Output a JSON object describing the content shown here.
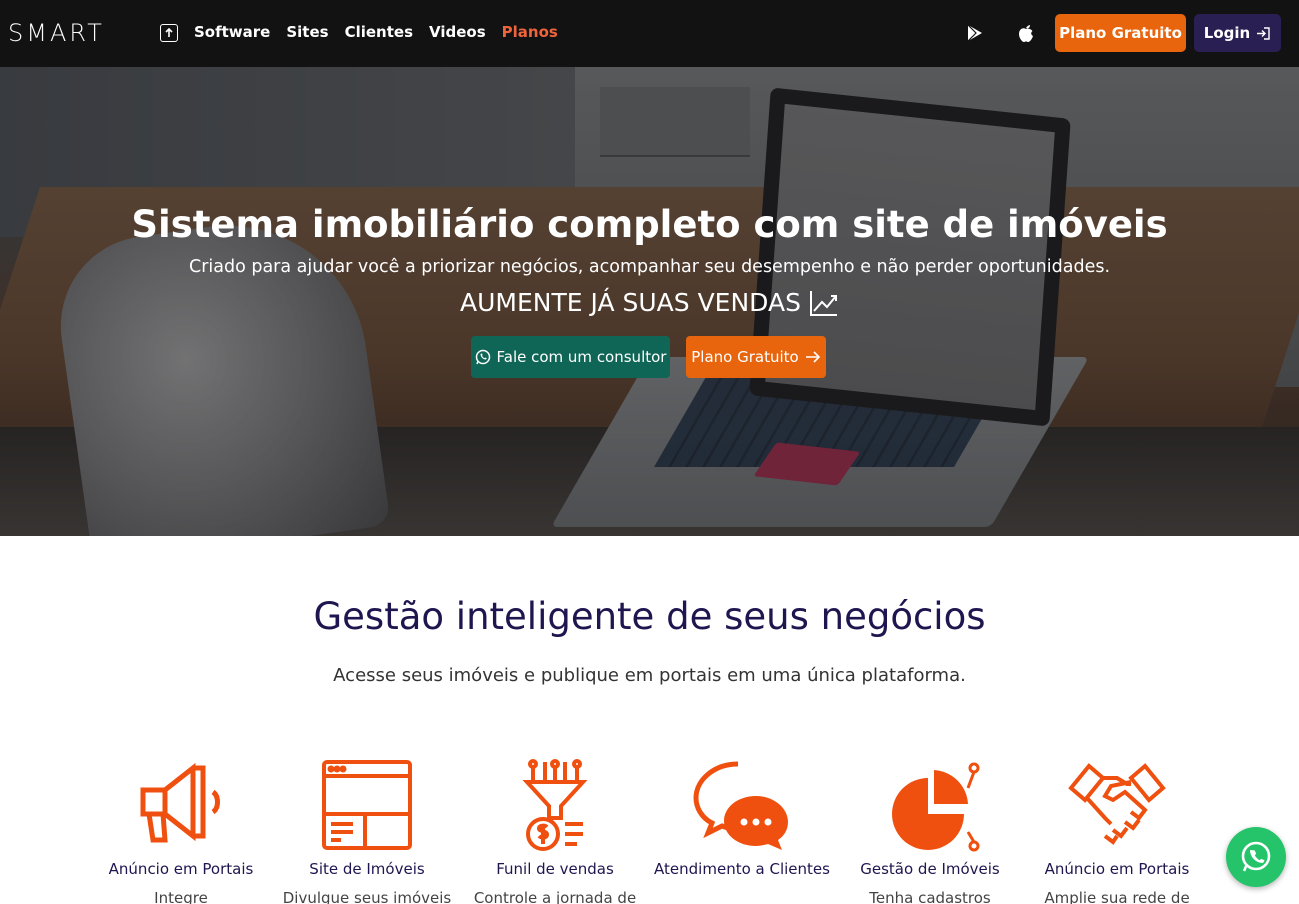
{
  "nav": {
    "logo": "SMART",
    "links": [
      "Software",
      "Sites",
      "Clientes",
      "Videos",
      "Planos"
    ],
    "plano_button": "Plano Gratuito",
    "login_button": "Login"
  },
  "hero": {
    "title": "Sistema imobiliário completo com site de imóveis",
    "subtitle": "Criado para ajudar você a priorizar negócios, acompanhar seu desempenho e não perder oportunidades.",
    "cta_text": "AUMENTE JÁ SUAS VENDAS",
    "consultor_button": "Fale com um consultor",
    "plano_button": "Plano Gratuito"
  },
  "section": {
    "title": "Gestão inteligente de seus negócios",
    "subtitle": "Acesse seus imóveis e publique em portais em uma única plataforma."
  },
  "features": [
    {
      "title": "Anúncio em Portais",
      "desc": "Integre",
      "icon": "megaphone-icon"
    },
    {
      "title": "Site de Imóveis",
      "desc": "Divulgue seus imóveis",
      "icon": "website-icon"
    },
    {
      "title": "Funil de vendas",
      "desc": "Controle a jornada de",
      "icon": "funnel-icon"
    },
    {
      "title": "Atendimento a Clientes",
      "desc": "",
      "icon": "chat-icon"
    },
    {
      "title": "Gestão de Imóveis",
      "desc": "Tenha cadastros",
      "icon": "pie-chart-icon"
    },
    {
      "title": "Anúncio em Portais",
      "desc": "Amplie sua rede de",
      "icon": "handshake-icon"
    }
  ],
  "colors": {
    "accent": "#e8650d",
    "nav_bg": "#121212",
    "login_bg": "#2a1f52",
    "consultor_bg": "#0f6656",
    "heading": "#1f1650",
    "whatsapp": "#25c36a",
    "icon": "#f0500f"
  }
}
